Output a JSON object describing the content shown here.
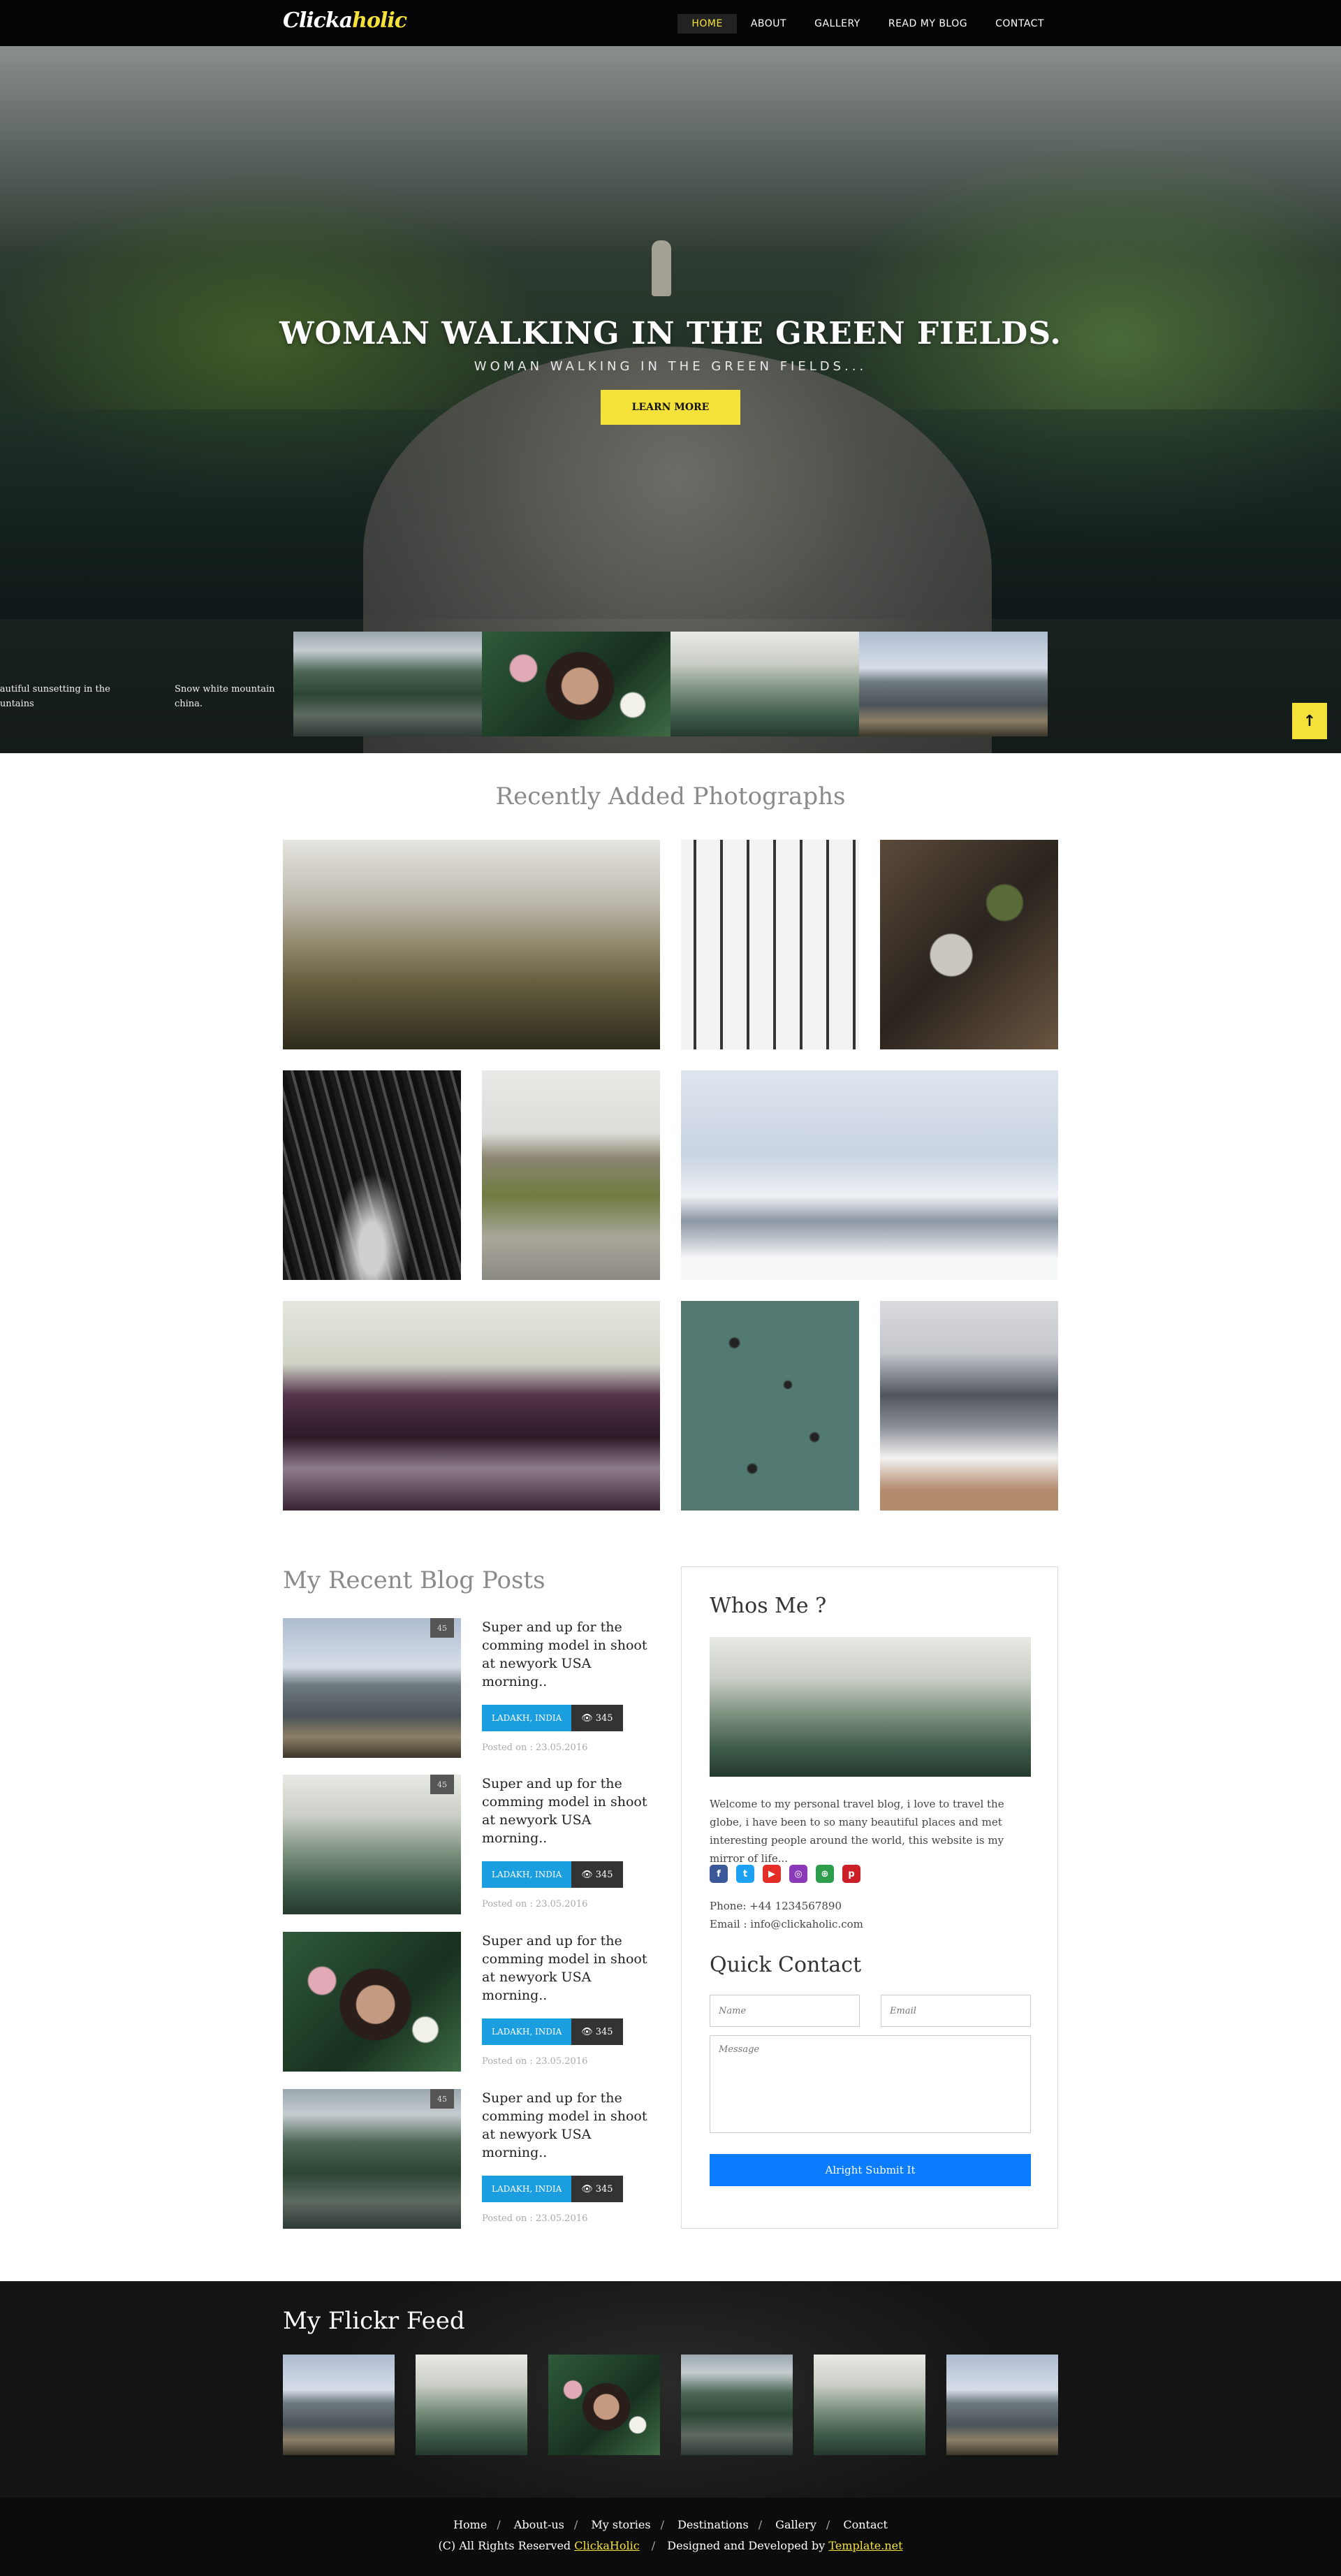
{
  "brand": {
    "logo_main": "Clicka",
    "logo_accent": "holic"
  },
  "nav": [
    {
      "label": "HOME",
      "active": true
    },
    {
      "label": "ABOUT"
    },
    {
      "label": "GALLERY"
    },
    {
      "label": "READ MY BLOG"
    },
    {
      "label": "CONTACT"
    }
  ],
  "hero": {
    "title": "WOMAN WALKING IN THE GREEN FIELDS.",
    "subtitle": "WOMAN WALKING IN THE GREEN FIELDS...",
    "button": "LEARN MORE",
    "captions": [
      "eautiful sunsetting in the ountains",
      "Snow white mountain china."
    ],
    "scroll_top_icon": "↑"
  },
  "gallery": {
    "title": "Recently Added Photographs"
  },
  "blog": {
    "title": "My Recent Blog Posts",
    "posts": [
      {
        "title": "Super and up for the comming model in shoot at newyork USA morning..",
        "location": "LADAKH, INDIA",
        "views": "345",
        "date": "Posted on : 23.05.2016",
        "comments": "45"
      },
      {
        "title": "Super and up for the comming model in shoot at newyork USA morning..",
        "location": "LADAKH, INDIA",
        "views": "345",
        "date": "Posted on : 23.05.2016",
        "comments": "45"
      },
      {
        "title": "Super and up for the comming model in shoot at newyork USA morning..",
        "location": "LADAKH, INDIA",
        "views": "345",
        "date": "Posted on : 23.05.2016",
        "comments": "45"
      },
      {
        "title": "Super and up for the comming model in shoot at newyork USA morning..",
        "location": "LADAKH, INDIA",
        "views": "345",
        "date": "Posted on : 23.05.2016",
        "comments": "45"
      }
    ]
  },
  "sidebar": {
    "about_title": "Whos Me ?",
    "about_text": "Welcome to my personal travel blog, i love to travel the globe, i have been to so many beautiful places and met interesting people around the world, this website is my mirror of life...",
    "phone": "Phone: +44 1234567890",
    "email": "Email : info@clickaholic.com",
    "contact_title": "Quick Contact",
    "name_placeholder": "Name",
    "email_placeholder": "Email",
    "message_placeholder": "Message",
    "submit": "Alright Submit It",
    "social_colors": {
      "facebook": "#3b5998",
      "twitter": "#1da1f2",
      "youtube": "#e52d27",
      "instagram": "#8a3ab9",
      "dribbble": "#2e9e4d",
      "pinterest": "#cb2027"
    }
  },
  "flickr": {
    "title": "My Flickr Feed"
  },
  "footer": {
    "links": [
      "Home",
      "About-us",
      "My stories",
      "Destinations",
      "Gallery",
      "Contact"
    ],
    "copy_prefix": "(C) All Rights Reserved",
    "copy_brand": "ClickaHolic",
    "copy_mid": "Designed and Developed by",
    "copy_dev": "Template.net"
  }
}
